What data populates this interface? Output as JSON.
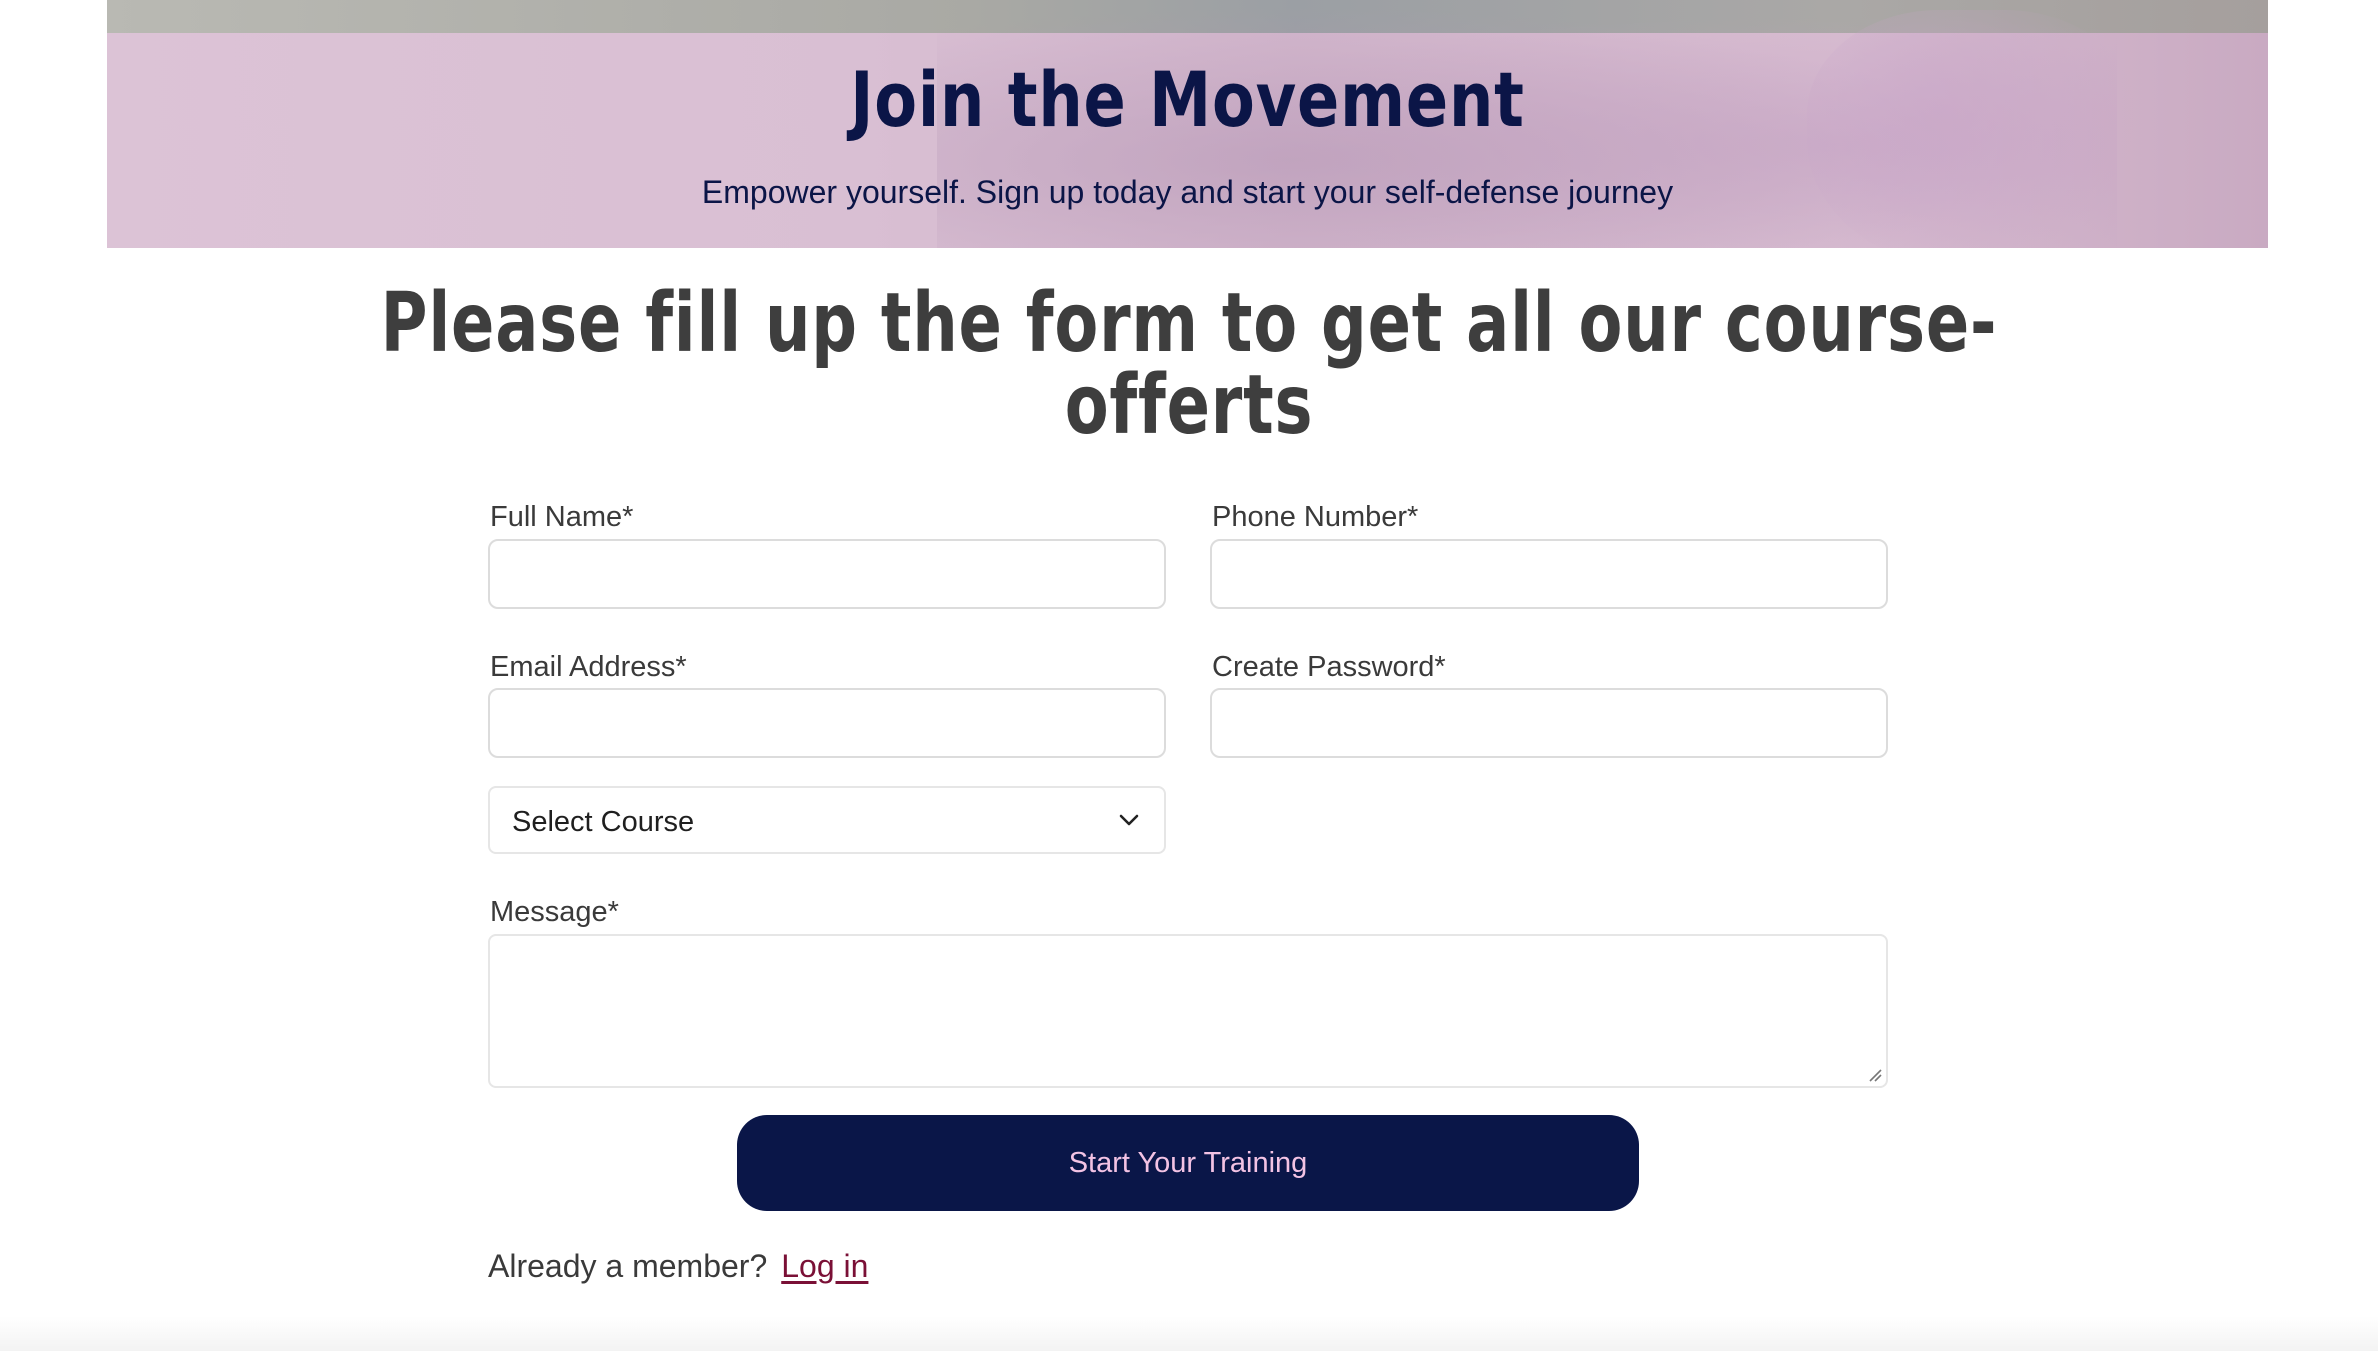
{
  "hero": {
    "title": "Join the Movement",
    "subtitle": "Empower yourself. Sign up today and start your self-defense journey"
  },
  "heading": "Please fill up the form to get all our course-offerts",
  "form": {
    "full_name": {
      "label": "Full Name*",
      "value": ""
    },
    "phone": {
      "label": "Phone Number*",
      "value": ""
    },
    "email": {
      "label": "Email Address*",
      "value": ""
    },
    "password": {
      "label": "Create Password*",
      "value": ""
    },
    "course": {
      "selected": "Select Course",
      "icon": "chevron-down-icon"
    },
    "message": {
      "label": "Message*",
      "value": ""
    },
    "submit_label": "Start Your Training"
  },
  "member": {
    "prompt": "Already a member?",
    "link_label": "Log in"
  },
  "colors": {
    "navy": "#0a1648",
    "button_text": "#f3c3e4",
    "link": "#7a1036",
    "heading": "#3e3e3e"
  }
}
